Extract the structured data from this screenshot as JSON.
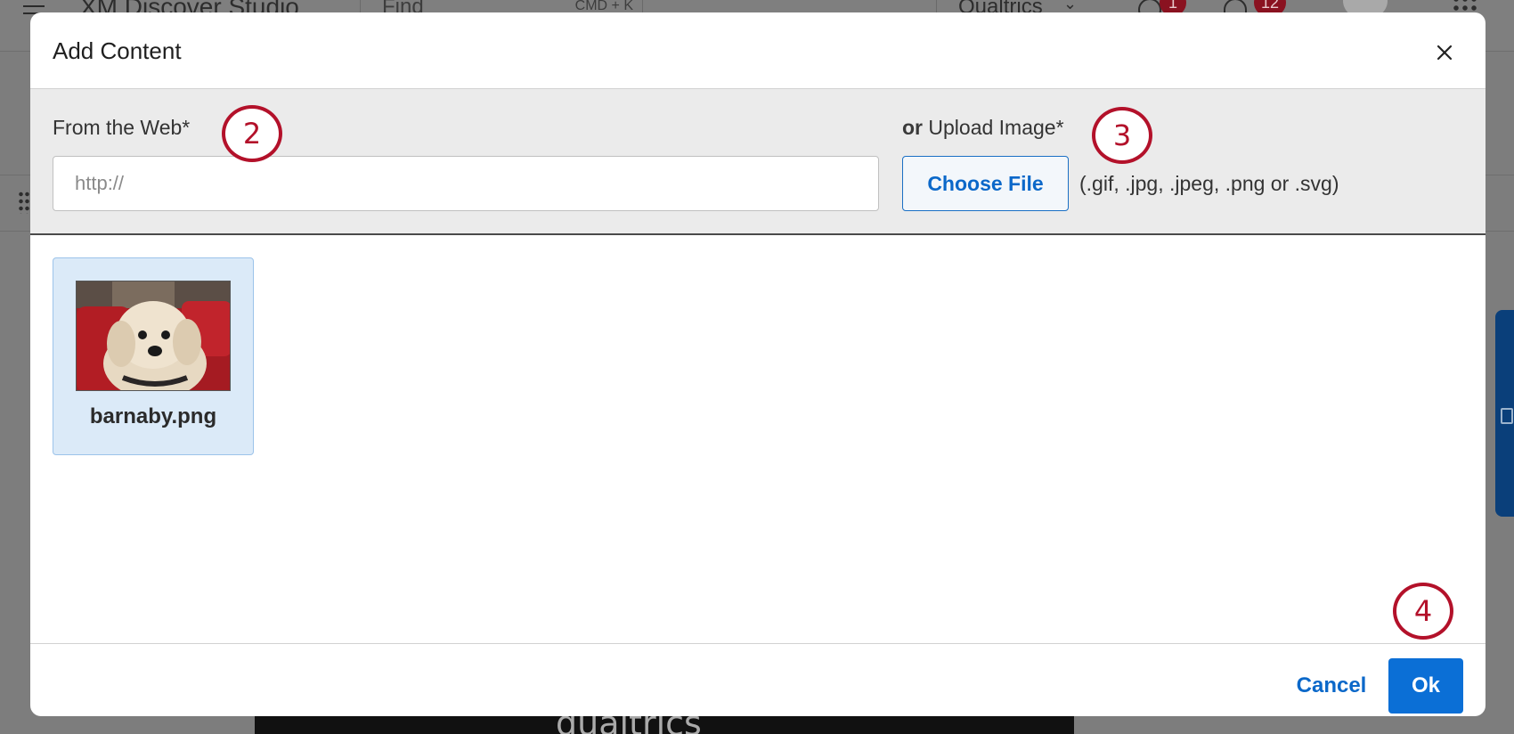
{
  "background": {
    "app_title": "XM Discover Studio",
    "find_label": "Find",
    "find_shortcut": "CMD + K",
    "brand_selector": "Qualtrics",
    "notifications_badge": "12",
    "help_badge": "1",
    "footer_logo_text": "qualtrics"
  },
  "modal": {
    "title": "Add Content",
    "close_icon": "close-icon",
    "web": {
      "label": "From the Web*",
      "placeholder": "http://",
      "value": ""
    },
    "upload": {
      "or": "or",
      "label": "Upload Image*",
      "button": "Choose File",
      "formats": "(.gif, .jpg, .jpeg, .png or .svg)"
    },
    "images": [
      {
        "name": "barnaby.png",
        "selected": true
      }
    ],
    "footer": {
      "cancel": "Cancel",
      "ok": "Ok"
    }
  },
  "annotations": [
    "2",
    "3",
    "4"
  ],
  "colors": {
    "primary": "#0b6fd6",
    "annotation": "#b3112a",
    "selected_card": "#dbeaf8",
    "panel_bg": "#ebebeb"
  }
}
